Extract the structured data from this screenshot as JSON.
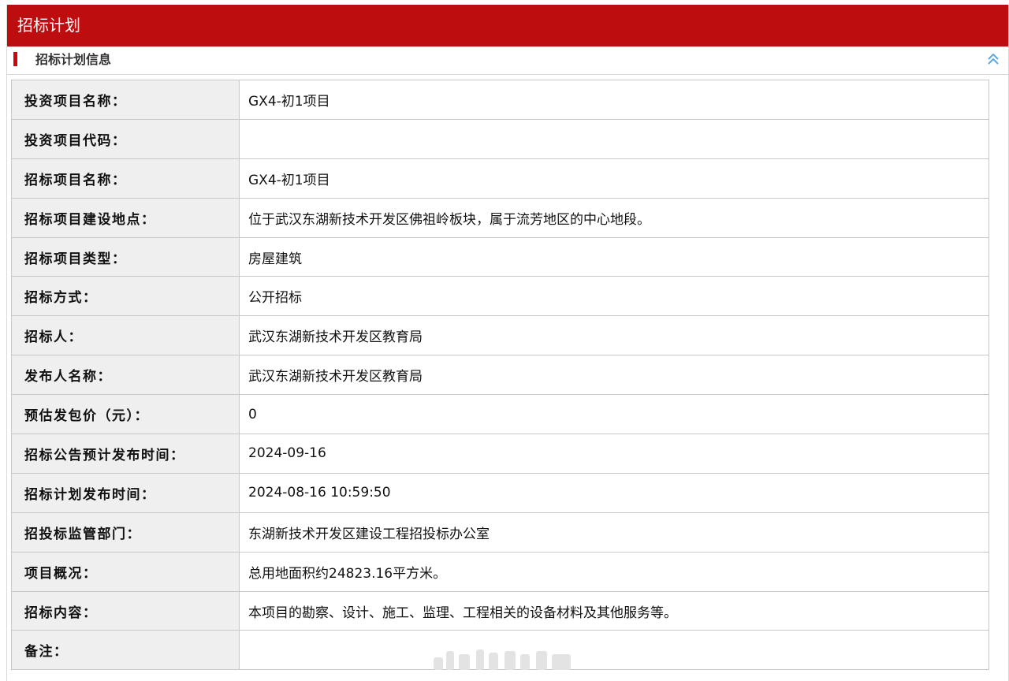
{
  "header": {
    "title": "招标计划"
  },
  "section": {
    "title": "招标计划信息",
    "collapse_icon": "double-chevron-up-icon"
  },
  "rows": [
    {
      "label": "投资项目名称：",
      "value": "GX4-初1项目"
    },
    {
      "label": "投资项目代码：",
      "value": ""
    },
    {
      "label": "招标项目名称：",
      "value": "GX4-初1项目"
    },
    {
      "label": "招标项目建设地点：",
      "value": "位于武汉东湖新技术开发区佛祖岭板块，属于流芳地区的中心地段。"
    },
    {
      "label": "招标项目类型：",
      "value": "房屋建筑"
    },
    {
      "label": "招标方式：",
      "value": "公开招标"
    },
    {
      "label": "招标人：",
      "value": "武汉东湖新技术开发区教育局"
    },
    {
      "label": "发布人名称：",
      "value": "武汉东湖新技术开发区教育局"
    },
    {
      "label": "预估发包价（元）：",
      "value": "0"
    },
    {
      "label": "招标公告预计发布时间：",
      "value": "2024-09-16"
    },
    {
      "label": "招标计划发布时间：",
      "value": "2024-08-16 10:59:50"
    },
    {
      "label": "招投标监管部门：",
      "value": "东湖新技术开发区建设工程招投标办公室"
    },
    {
      "label": "项目概况：",
      "value": "总用地面积约24823.16平方米。"
    },
    {
      "label": "招标内容：",
      "value": "本项目的勘察、设计、施工、监理、工程相关的设备材料及其他服务等。"
    },
    {
      "label": "备注：",
      "value": ""
    }
  ],
  "colors": {
    "header_bg": "#be0d0f",
    "marker": "#d2040a",
    "label_bg": "#efefef",
    "icon": "#5aa8e6"
  }
}
